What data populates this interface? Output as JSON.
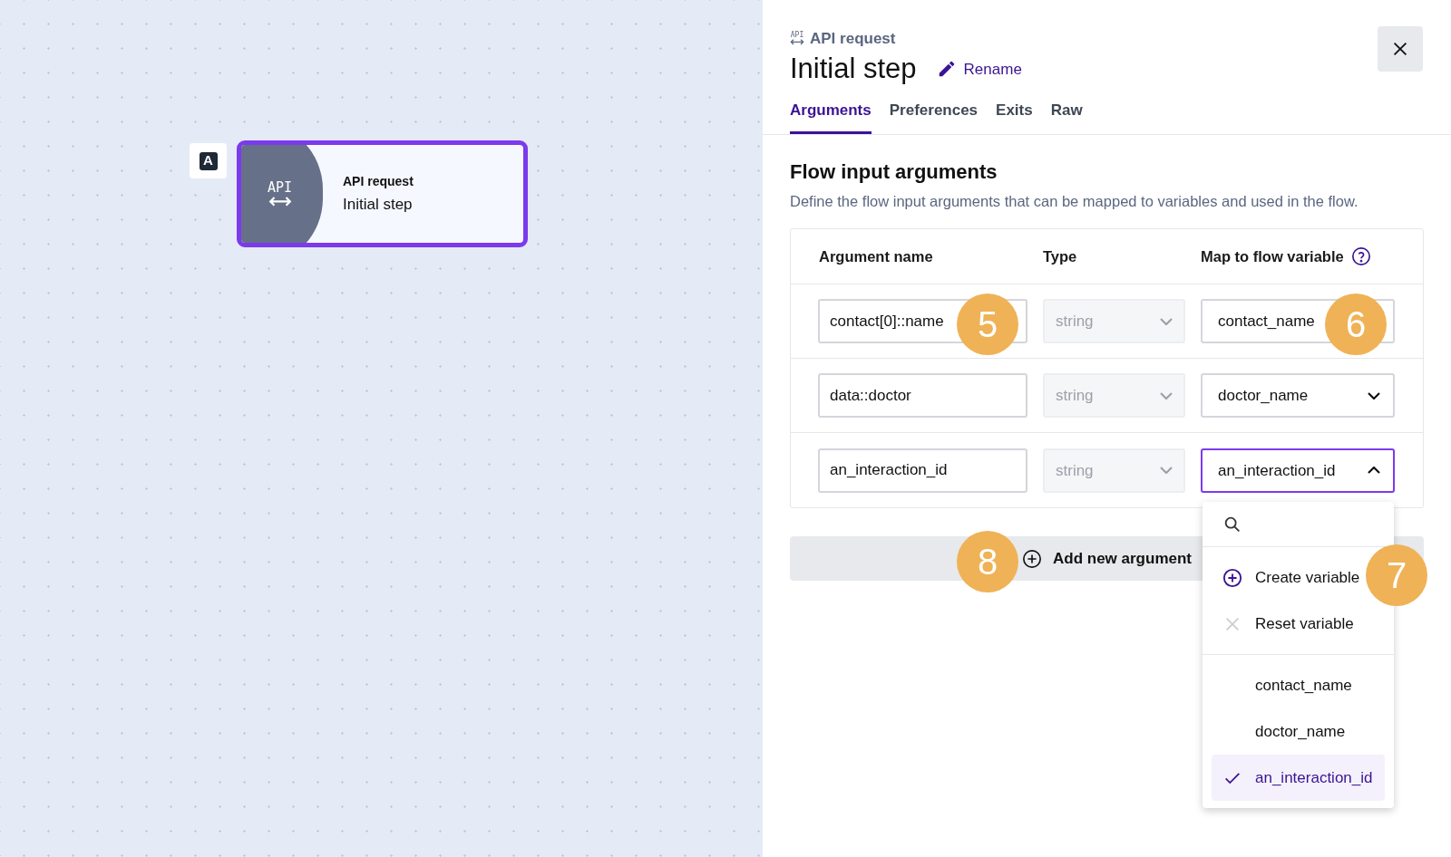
{
  "canvas": {
    "node": {
      "badge": "A",
      "icon_text": "API",
      "type": "API request",
      "title": "Initial step",
      "selected": true
    }
  },
  "panel": {
    "icon_text": "API",
    "subtitle": "API request",
    "title": "Initial step",
    "rename": "Rename"
  },
  "tabs": [
    {
      "label": "Arguments",
      "selected": true
    },
    {
      "label": "Preferences",
      "selected": false
    },
    {
      "label": "Exits",
      "selected": false
    },
    {
      "label": "Raw",
      "selected": false
    }
  ],
  "section": {
    "title": "Flow input arguments",
    "description": "Define the flow input arguments that can be mapped to variables and used in the flow."
  },
  "table": {
    "columns": [
      "Argument name",
      "Type",
      "Map to flow variable"
    ],
    "rows": [
      {
        "argument": "contact[0]::name",
        "type": "string",
        "variable": "contact_name",
        "expanded": false
      },
      {
        "argument": "data::doctor",
        "type": "string",
        "variable": "doctor_name",
        "expanded": false
      },
      {
        "argument": "an_interaction_id",
        "type": "string",
        "variable": "an_interaction_id",
        "expanded": true
      }
    ]
  },
  "add_button": "Add new argument",
  "dropdown": {
    "actions": [
      {
        "kind": "create",
        "label": "Create variable"
      },
      {
        "kind": "reset",
        "label": "Reset variable"
      }
    ],
    "options": [
      {
        "label": "contact_name",
        "selected": false
      },
      {
        "label": "doctor_name",
        "selected": false
      },
      {
        "label": "an_interaction_id",
        "selected": true
      }
    ]
  },
  "callouts": [
    "5",
    "6",
    "8",
    "7"
  ]
}
